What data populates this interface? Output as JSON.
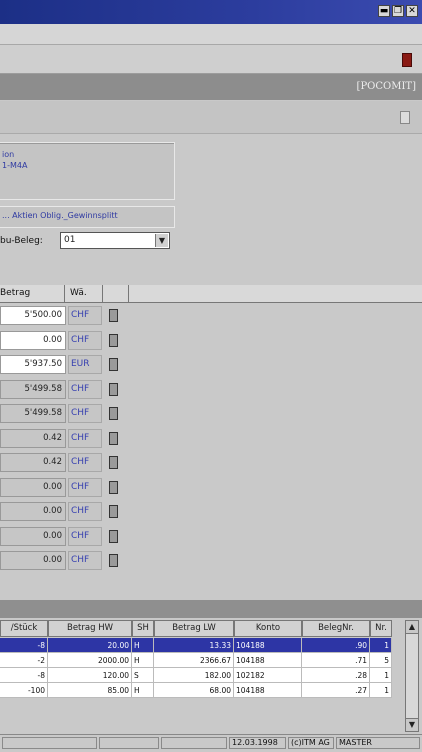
{
  "window": {
    "controls": [
      "▬",
      "❐",
      "✕"
    ]
  },
  "header": {
    "title": "[POCOMIT]"
  },
  "info": {
    "line1": "ion",
    "line2": "1-M4A"
  },
  "attributes_text": "... Aktien  Oblig._Gewinnsplitt",
  "beleg": {
    "label": "bu-Beleg:",
    "value": "01"
  },
  "grid": {
    "columns": [
      "Betrag",
      "Wä."
    ],
    "rows": [
      {
        "amount": "5'500.00",
        "currency": "CHF",
        "style": "white"
      },
      {
        "amount": "0.00",
        "currency": "CHF",
        "style": "white"
      },
      {
        "amount": "5'937.50",
        "currency": "EUR",
        "style": "white"
      },
      {
        "amount": "5'499.58",
        "currency": "CHF",
        "style": "grey"
      },
      {
        "amount": "5'499.58",
        "currency": "CHF",
        "style": "grey"
      },
      {
        "amount": "0.42",
        "currency": "CHF",
        "style": "grey"
      },
      {
        "amount": "0.42",
        "currency": "CHF",
        "style": "grey"
      },
      {
        "amount": "0.00",
        "currency": "CHF",
        "style": "grey"
      },
      {
        "amount": "0.00",
        "currency": "CHF",
        "style": "grey"
      },
      {
        "amount": "0.00",
        "currency": "CHF",
        "style": "grey"
      },
      {
        "amount": "0.00",
        "currency": "CHF",
        "style": "grey"
      }
    ]
  },
  "table": {
    "columns": [
      "/Stück",
      "Betrag HW",
      "SH",
      "Betrag LW",
      "Konto",
      "BelegNr.",
      "Nr."
    ],
    "rows": [
      {
        "stueck": "-8",
        "betrag_hw": "20.00",
        "sh": "H",
        "betrag_lw": "13.33",
        "konto": "104188",
        "belegnr": ".90",
        "nr": "1",
        "selected": true
      },
      {
        "stueck": "-2",
        "betrag_hw": "2000.00",
        "sh": "H",
        "betrag_lw": "2366.67",
        "konto": "104188",
        "belegnr": ".71",
        "nr": "5",
        "selected": false
      },
      {
        "stueck": "-8",
        "betrag_hw": "120.00",
        "sh": "S",
        "betrag_lw": "182.00",
        "konto": "102182",
        "belegnr": ".28",
        "nr": "1",
        "selected": false
      },
      {
        "stueck": "-100",
        "betrag_hw": "85.00",
        "sh": "H",
        "betrag_lw": "68.00",
        "konto": "104188",
        "belegnr": ".27",
        "nr": "1",
        "selected": false
      }
    ]
  },
  "status": {
    "date": "12.03.1998",
    "company": "(c)ITM AG",
    "user": "MASTER"
  },
  "colors": {
    "title_bar": "#1c2f86",
    "selection": "#2d35a5",
    "link_text": "#2f3aa2",
    "header_bg": "#8d8d8d"
  }
}
